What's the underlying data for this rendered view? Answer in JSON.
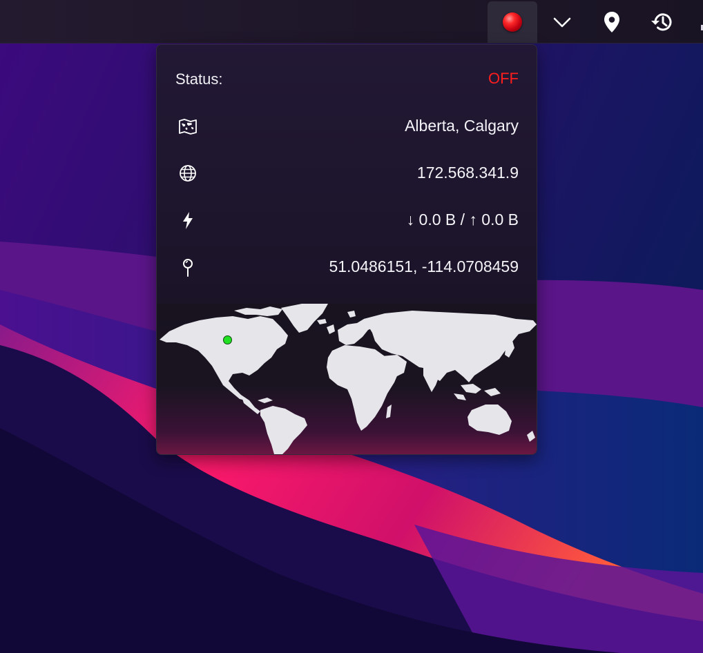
{
  "menubar": {
    "items": [
      {
        "name": "vpn-status-orb",
        "icon": "red-orb-icon",
        "active": true
      },
      {
        "name": "expand-menu",
        "icon": "chevron-down-icon"
      },
      {
        "name": "location",
        "icon": "map-pin-icon"
      },
      {
        "name": "history",
        "icon": "history-icon"
      }
    ]
  },
  "panel": {
    "status_label": "Status:",
    "status_value": "OFF",
    "location": "Alberta, Calgary",
    "ip_address": "172.568.341.9",
    "traffic": "↓ 0.0 B / ↑ 0.0 B",
    "coordinates": "51.0486151, -114.0708459",
    "icons": {
      "location": "map-icon",
      "ip": "globe-icon",
      "traffic": "lightning-icon",
      "coordinates": "pin-icon"
    }
  },
  "map": {
    "marker_color": "#22e022"
  },
  "colors": {
    "status_off": "#ff1e1e",
    "panel_bg": "#1b1427",
    "map_land": "#e6e5ea"
  }
}
